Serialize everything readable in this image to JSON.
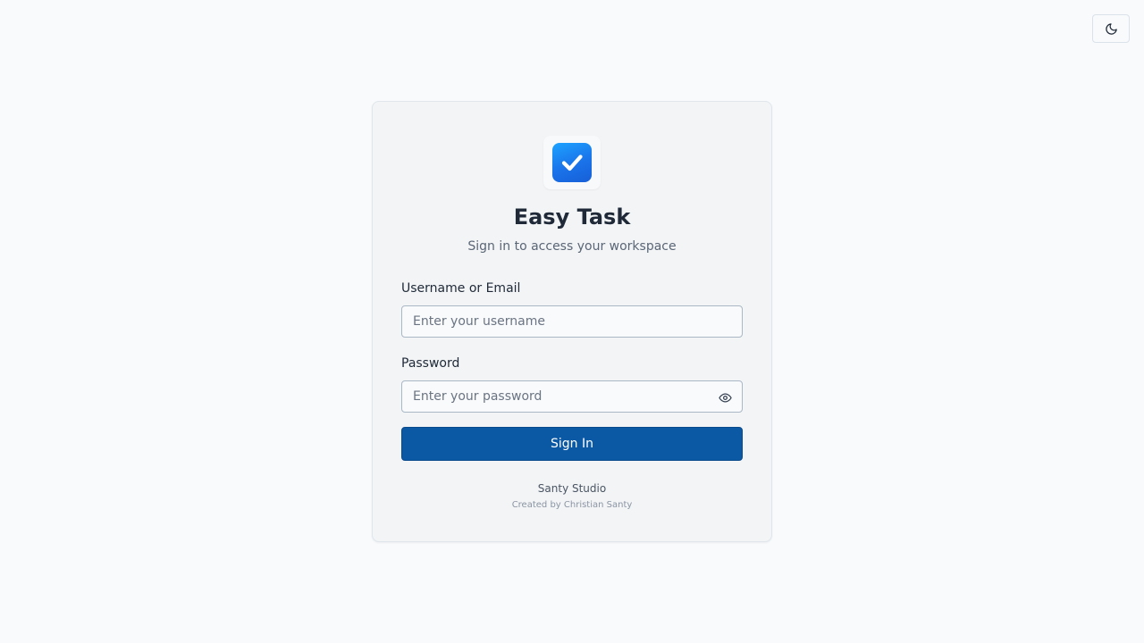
{
  "theme_toggle": {
    "icon": "moon-icon"
  },
  "brand": {
    "logo_icon": "checkmark-icon",
    "title": "Easy Task",
    "subtitle": "Sign in to access your workspace",
    "accent_color": "#1a73ea"
  },
  "form": {
    "username": {
      "label": "Username or Email",
      "value": "",
      "placeholder": "Enter your username"
    },
    "password": {
      "label": "Password",
      "value": "",
      "placeholder": "Enter your password",
      "toggle_icon": "eye-icon"
    },
    "submit_label": "Sign In",
    "submit_color": "#0b58a4"
  },
  "footer": {
    "studio": "Santy Studio",
    "credit": "Created by Christian Santy"
  }
}
